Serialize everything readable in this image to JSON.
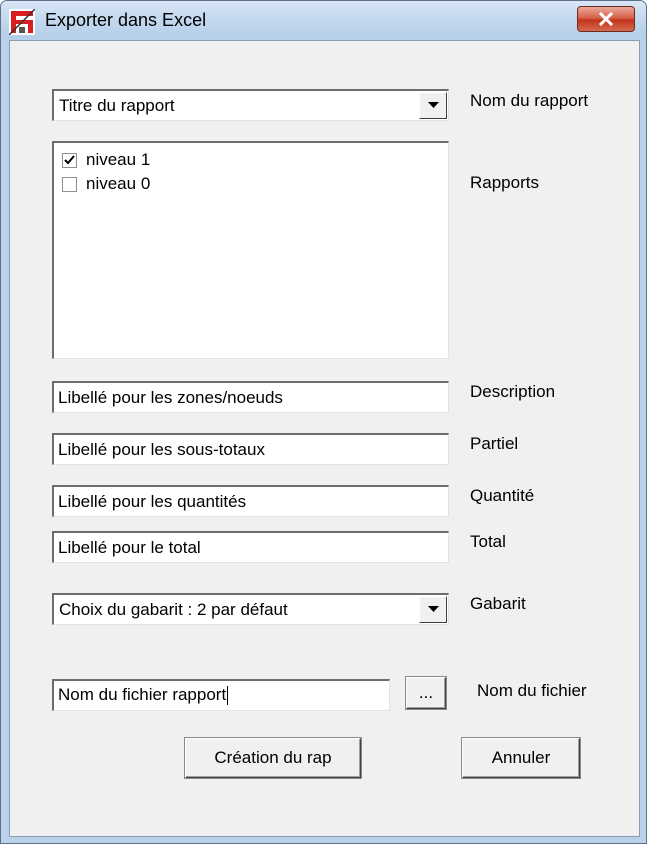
{
  "window": {
    "title": "Exporter dans Excel",
    "close_glyph": "✕"
  },
  "report_name": {
    "value": "Titre du rapport",
    "label": "Nom du rapport"
  },
  "reports": {
    "label": "Rapports",
    "items": [
      {
        "label": "niveau 1",
        "checked": true
      },
      {
        "label": "niveau 0",
        "checked": false
      }
    ]
  },
  "description": {
    "value": "Libellé pour les zones/noeuds",
    "label": "Description"
  },
  "partial": {
    "value": "Libellé pour les sous-totaux",
    "label": "Partiel"
  },
  "quantity": {
    "value": "Libellé pour les quantités",
    "label": "Quantité"
  },
  "total": {
    "value": "Libellé pour le total",
    "label": "Total"
  },
  "template": {
    "value": "Choix du gabarit : 2 par défaut",
    "label": "Gabarit"
  },
  "file": {
    "value": "Nom du fichier rapport",
    "browse_label": "...",
    "label": "Nom du fichier"
  },
  "buttons": {
    "create_label": "Création  du rap",
    "cancel_label": "Annuler"
  },
  "colors": {
    "titlebar": "#c3d8ee",
    "close_button": "#c9402a",
    "dialog_bg": "#f0f0f0"
  }
}
